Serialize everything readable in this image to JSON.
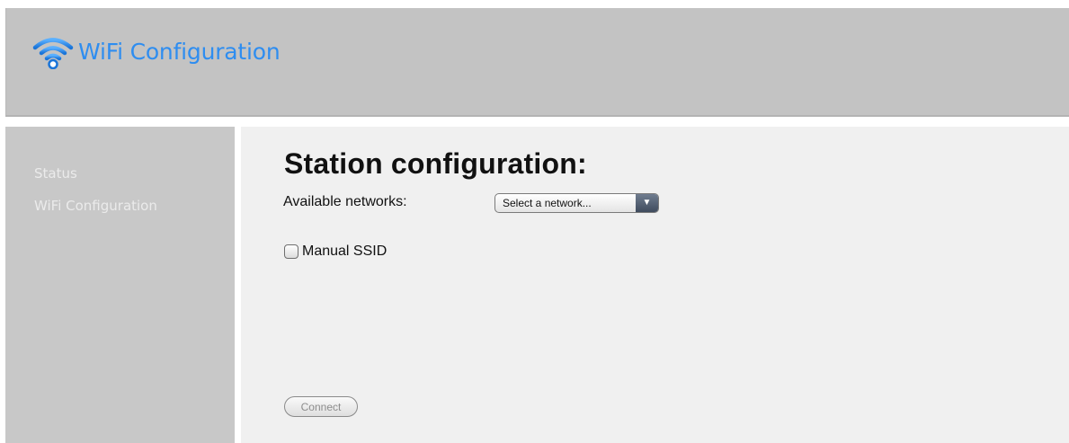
{
  "header": {
    "title": "WiFi Configuration",
    "icon": "wifi-icon",
    "accent_color": "#2e8df0"
  },
  "sidebar": {
    "items": [
      {
        "label": "Status"
      },
      {
        "label": "WiFi Configuration"
      }
    ]
  },
  "main": {
    "title": "Station configuration:",
    "networks_label": "Available networks:",
    "network_select": {
      "selected": "Select a network..."
    },
    "manual_ssid": {
      "label": "Manual SSID",
      "checked": false
    },
    "connect_label": "Connect",
    "connect_enabled": false
  }
}
